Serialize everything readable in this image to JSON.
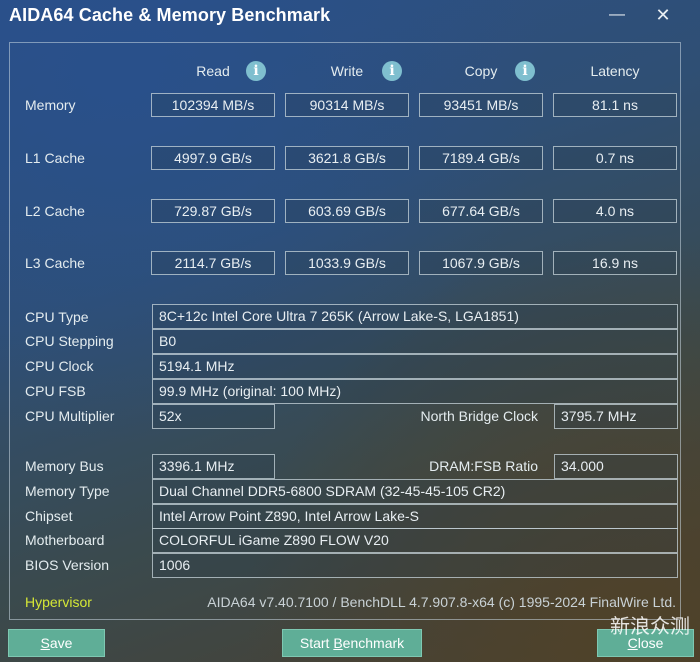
{
  "window": {
    "title": "AIDA64 Cache & Memory Benchmark",
    "minimize_glyph": "—",
    "close_glyph": "✕"
  },
  "columns": [
    {
      "label": "Read",
      "has_info": true
    },
    {
      "label": "Write",
      "has_info": true
    },
    {
      "label": "Copy",
      "has_info": true
    },
    {
      "label": "Latency",
      "has_info": false
    }
  ],
  "info_icon_glyph": "i",
  "benchmarks": [
    {
      "label": "Memory",
      "read": "102394 MB/s",
      "write": "90314 MB/s",
      "copy": "93451 MB/s",
      "latency": "81.1 ns"
    },
    {
      "label": "L1 Cache",
      "read": "4997.9 GB/s",
      "write": "3621.8 GB/s",
      "copy": "7189.4 GB/s",
      "latency": "0.7 ns"
    },
    {
      "label": "L2 Cache",
      "read": "729.87 GB/s",
      "write": "603.69 GB/s",
      "copy": "677.64 GB/s",
      "latency": "4.0 ns"
    },
    {
      "label": "L3 Cache",
      "read": "2114.7 GB/s",
      "write": "1033.9 GB/s",
      "copy": "1067.9 GB/s",
      "latency": "16.9 ns"
    }
  ],
  "cpu": {
    "type_label": "CPU Type",
    "type": "8C+12c Intel Core Ultra 7 265K  (Arrow Lake-S, LGA1851)",
    "stepping_label": "CPU Stepping",
    "stepping": "B0",
    "clock_label": "CPU Clock",
    "clock": "5194.1 MHz",
    "fsb_label": "CPU FSB",
    "fsb": "99.9 MHz  (original: 100 MHz)",
    "multiplier_label": "CPU Multiplier",
    "multiplier": "52x",
    "nb_clock_label": "North Bridge Clock",
    "nb_clock": "3795.7 MHz"
  },
  "memory": {
    "bus_label": "Memory Bus",
    "bus": "3396.1 MHz",
    "ratio_label": "DRAM:FSB Ratio",
    "ratio": "34.000",
    "type_label": "Memory Type",
    "type": "Dual Channel DDR5-6800 SDRAM  (32-45-45-105 CR2)",
    "chipset_label": "Chipset",
    "chipset": "Intel Arrow Point Z890, Intel Arrow Lake-S",
    "motherboard_label": "Motherboard",
    "motherboard": "COLORFUL iGame Z890 FLOW V20",
    "bios_label": "BIOS Version",
    "bios": "1006"
  },
  "footer": {
    "hypervisor": "Hypervisor",
    "version": "AIDA64 v7.40.7100 / BenchDLL 4.7.907.8-x64  (c) 1995-2024 FinalWire Ltd."
  },
  "buttons": {
    "save_mnemonic": "S",
    "save_rest": "ave",
    "start_pre": "Start ",
    "start_mnemonic": "B",
    "start_rest": "enchmark",
    "close_mnemonic": "C",
    "close_rest": "lose"
  },
  "watermark": "新浪众测",
  "colors": {
    "accent_button": "#5fae97",
    "hypervisor_text": "#d6e836",
    "info_icon": "#7fbfcf"
  }
}
